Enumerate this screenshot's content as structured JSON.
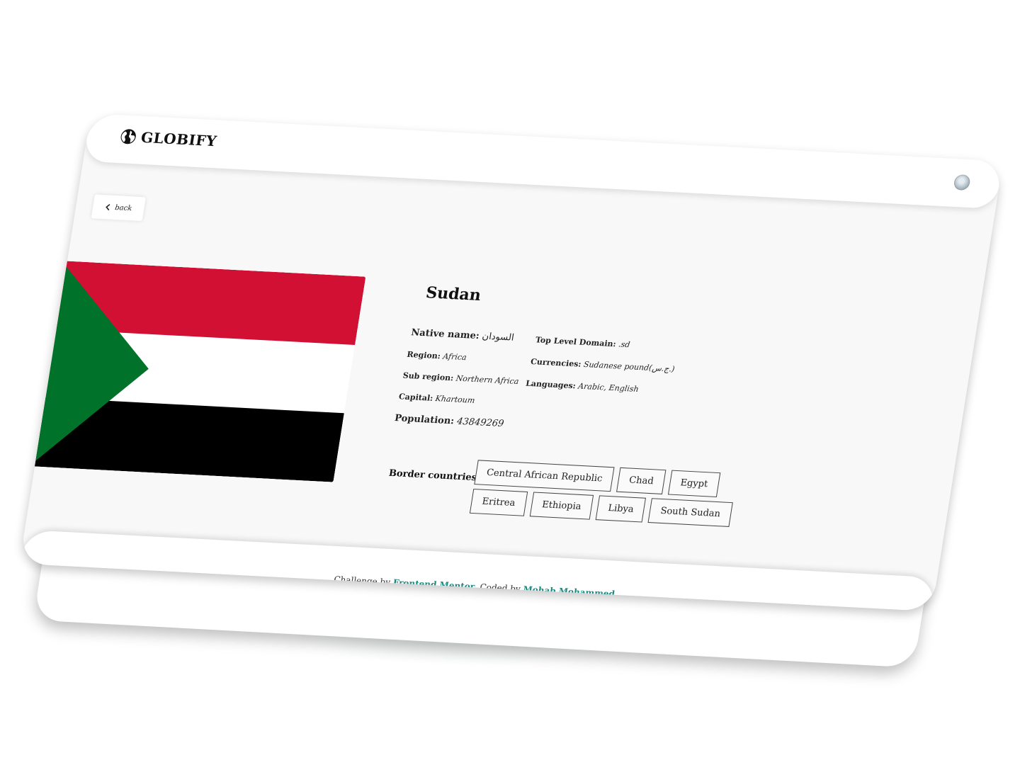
{
  "header": {
    "logo_text": "GLOBIFY"
  },
  "nav": {
    "back_label": "back"
  },
  "country": {
    "name": "Sudan",
    "native_name_label": "Native name:",
    "native_name": "السودان",
    "region_label": "Region:",
    "region": "Africa",
    "sub_region_label": "Sub region:",
    "sub_region": "Northern Africa",
    "capital_label": "Capital:",
    "capital": "Khartoum",
    "population_label": "Population:",
    "population": "43849269",
    "tld_label": "Top Level Domain:",
    "tld": ".sd",
    "currencies_label": "Currencies:",
    "currencies": "Sudanese pound(ج.س.)",
    "languages_label": "Languages:",
    "languages": "Arabic, English"
  },
  "border": {
    "label": "Border countries :",
    "countries": [
      "Central African Republic",
      "Chad",
      "Egypt",
      "Eritrea",
      "Ethiopia",
      "Libya",
      "South Sudan"
    ]
  },
  "flag_colors": {
    "red": "#d21034",
    "white": "#ffffff",
    "black": "#000000",
    "green": "#007229"
  },
  "footer": {
    "prefix": "Challenge by ",
    "link1": "Frontend Mentor",
    "middle": ". Coded by ",
    "link2": "Mohab Mohammed",
    "suffix": "."
  },
  "icons": {
    "logo": "globe-icon",
    "back": "chevron-left-icon",
    "theme": "moon-icon"
  }
}
